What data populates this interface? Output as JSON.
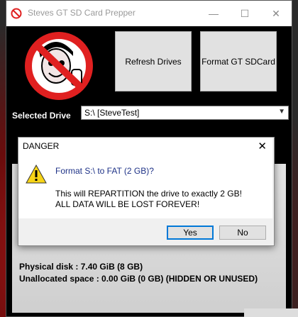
{
  "window": {
    "title": "Steves GT SD Card Prepper"
  },
  "buttons": {
    "refresh": "Refresh Drives",
    "format": "Format GT SDCard"
  },
  "drive": {
    "label": "Selected Drive",
    "value": "S:\\ [SteveTest]"
  },
  "info": {
    "physical": "Physical disk : 7.40 GiB (8 GB)",
    "unallocated": "Unallocated space : 0.00 GiB (0 GB) (HIDDEN OR UNUSED)"
  },
  "dialog": {
    "title": "DANGER",
    "heading": "Format S:\\ to FAT (2 GB)?",
    "line1": "This will REPARTITION the drive to exactly 2 GB!",
    "line2": "ALL DATA WILL BE LOST FOREVER!",
    "yes": "Yes",
    "no": "No"
  },
  "colors": {
    "danger_red": "#e02020",
    "dialog_heading": "#1e3287"
  }
}
